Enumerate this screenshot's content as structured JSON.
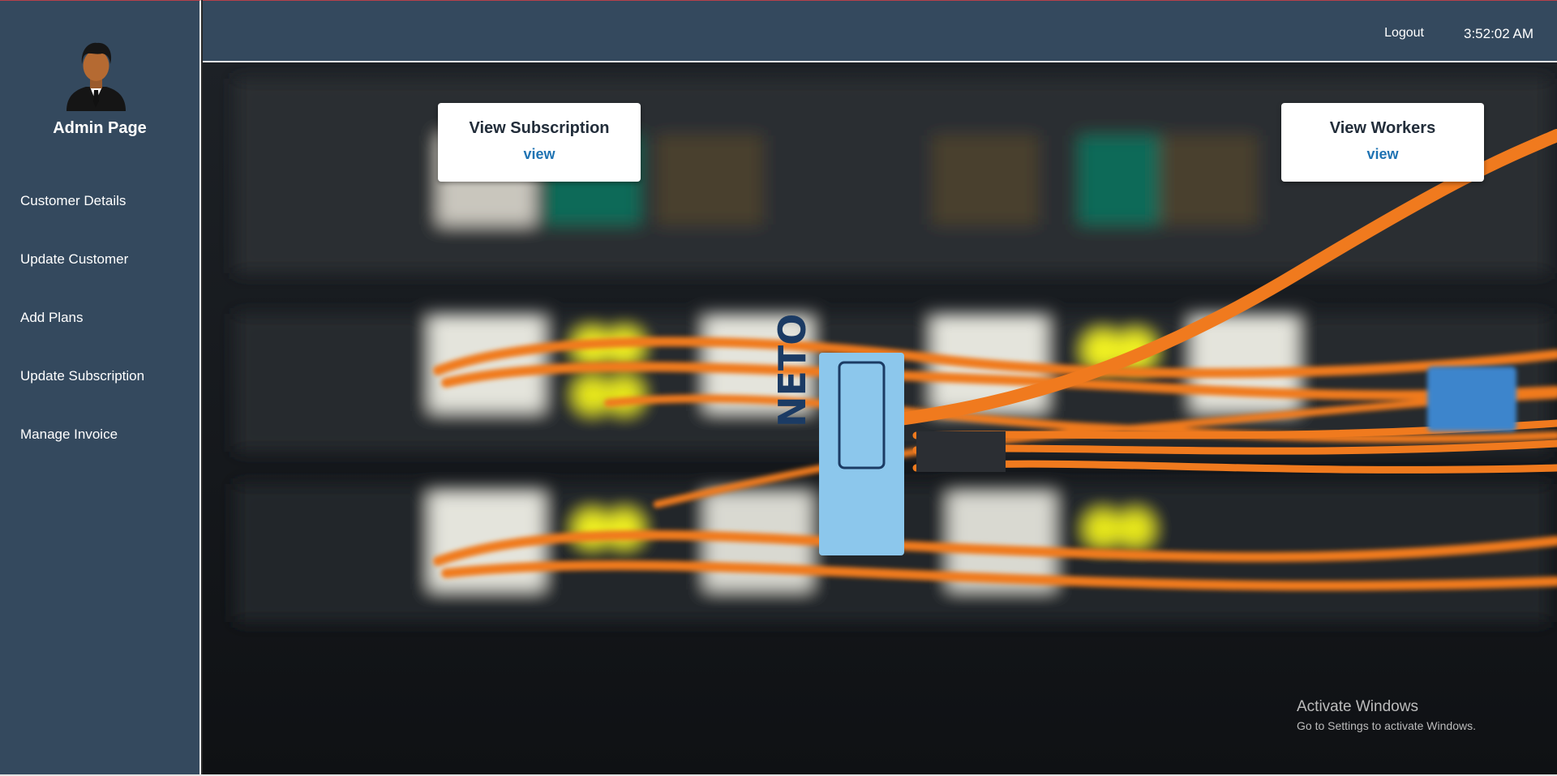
{
  "sidebar": {
    "avatar_icon": "admin-avatar-icon",
    "title": "Admin Page",
    "items": [
      {
        "label": "Customer Details"
      },
      {
        "label": "Update Customer"
      },
      {
        "label": "Add Plans"
      },
      {
        "label": "Update Subscription"
      },
      {
        "label": "Manage Invoice"
      }
    ]
  },
  "header": {
    "logout_label": "Logout",
    "clock": "3:52:02 AM"
  },
  "main": {
    "background": "fiber-optic-cables-image",
    "cards": [
      {
        "title": "View Subscription",
        "link": "view"
      },
      {
        "title": "View Workers",
        "link": "view"
      }
    ]
  },
  "watermark": {
    "title": "Activate Windows",
    "subtitle": "Go to Settings to activate Windows."
  },
  "colors": {
    "sidebar_bg": "#34495e",
    "card_title": "#222d3a",
    "link": "#1f73b3",
    "cable": "#f07a1e"
  }
}
